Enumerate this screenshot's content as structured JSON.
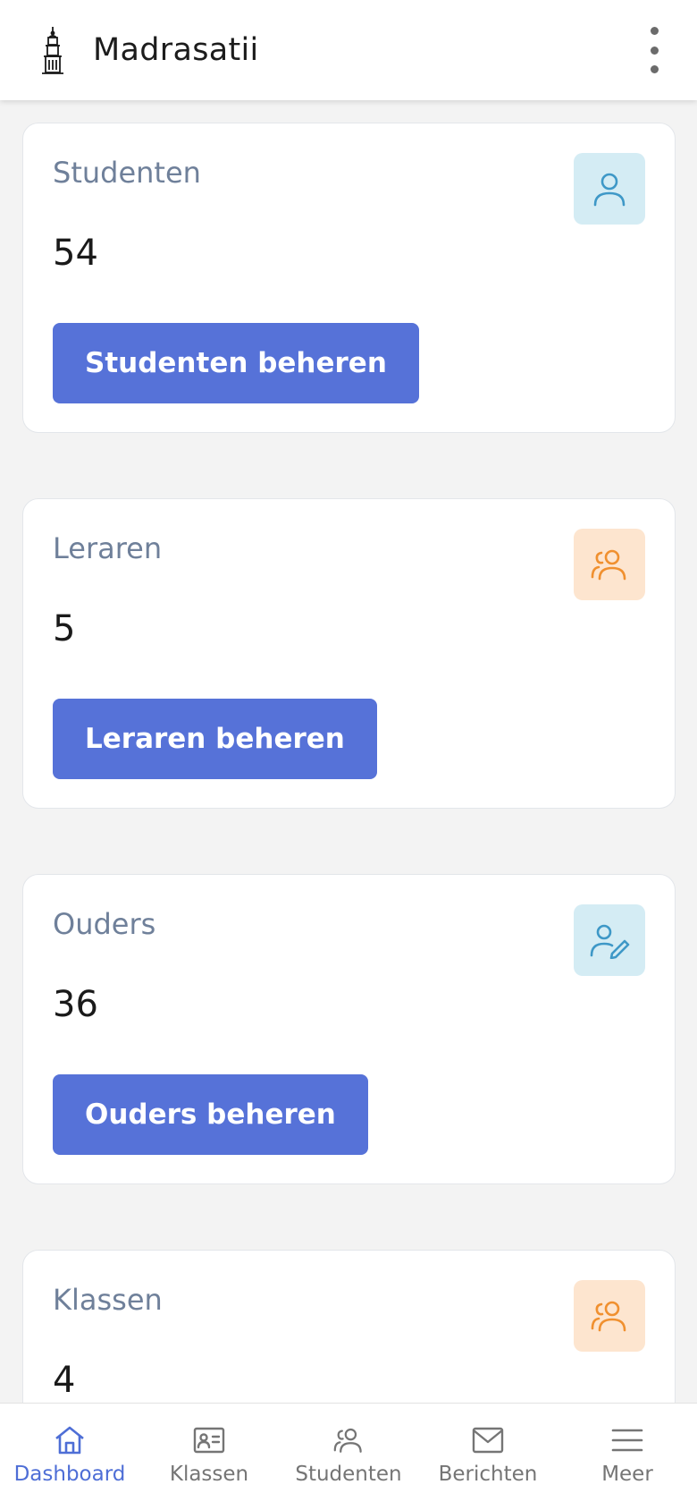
{
  "app": {
    "title": "Madrasatii",
    "logo_icon": "minaret-icon",
    "menu_icon": "more-vertical-icon"
  },
  "cards": [
    {
      "label": "Studenten",
      "value": "54",
      "button": "Studenten beheren",
      "icon": "user-icon",
      "icon_color": "#3e98c7",
      "icon_bg": "#d4ecf4"
    },
    {
      "label": "Leraren",
      "value": "5",
      "button": "Leraren beheren",
      "icon": "users-icon",
      "icon_color": "#f0902f",
      "icon_bg": "#fde5cf"
    },
    {
      "label": "Ouders",
      "value": "36",
      "button": "Ouders beheren",
      "icon": "user-edit-icon",
      "icon_color": "#3e98c7",
      "icon_bg": "#d4ecf4"
    },
    {
      "label": "Klassen",
      "value": "4",
      "icon": "users-icon",
      "icon_color": "#f0902f",
      "icon_bg": "#fde5cf"
    }
  ],
  "nav": [
    {
      "label": "Dashboard",
      "icon": "home-icon",
      "active": true
    },
    {
      "label": "Klassen",
      "icon": "id-card-icon",
      "active": false
    },
    {
      "label": "Studenten",
      "icon": "users-icon",
      "active": false
    },
    {
      "label": "Berichten",
      "icon": "mail-icon",
      "active": false
    },
    {
      "label": "Meer",
      "icon": "menu-icon",
      "active": false
    }
  ],
  "colors": {
    "primary": "#5672d8",
    "active_nav": "#4e6ed6",
    "label": "#6f809a"
  }
}
